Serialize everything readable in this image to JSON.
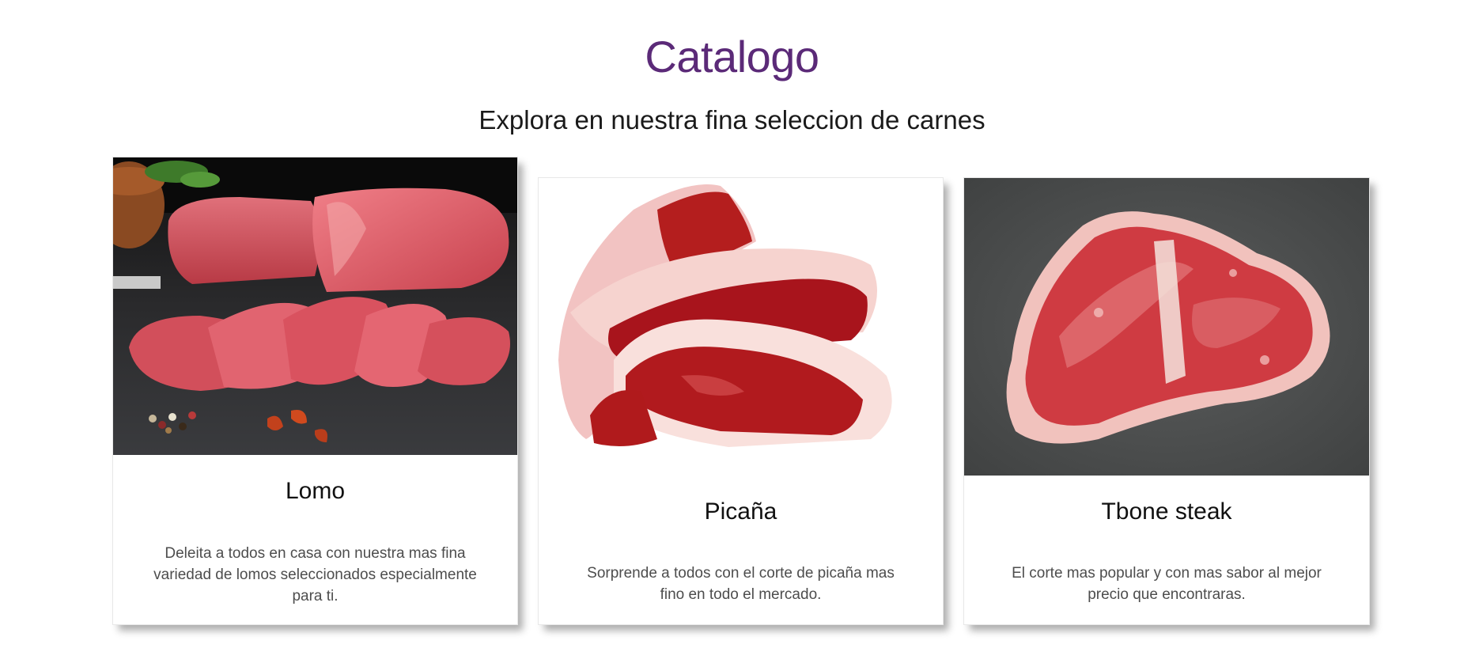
{
  "header": {
    "title": "Catalogo",
    "subtitle": "Explora en nuestra fina seleccion de carnes"
  },
  "colors": {
    "title": "#5b2a78",
    "text": "#1a1a1a",
    "description": "#4d4d4d"
  },
  "products": [
    {
      "name": "Lomo",
      "description": "Deleita a todos en casa con nuestra mas fina variedad de lomos seleccionados especialmente para ti.",
      "image": "lomo-photo"
    },
    {
      "name": "Picaña",
      "description": "Sorprende a todos con el corte de picaña mas fino en todo el mercado.",
      "image": "picana-photo"
    },
    {
      "name": "Tbone steak",
      "description": "El corte mas popular y con mas sabor al mejor precio que encontraras.",
      "image": "tbone-photo"
    }
  ]
}
